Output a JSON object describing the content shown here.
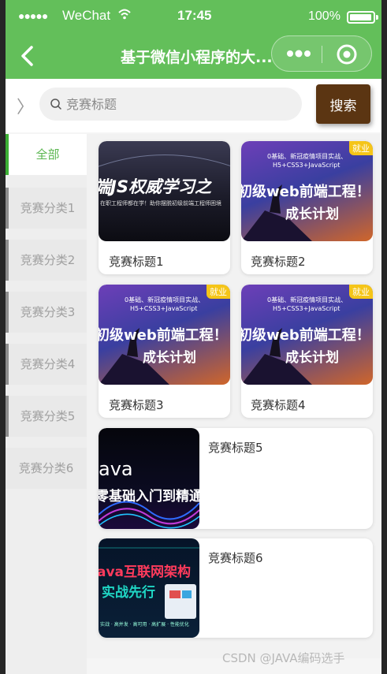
{
  "status_bar": {
    "signal_dots": "●●●●●",
    "carrier": "WeChat",
    "time": "17:45",
    "battery": "100%"
  },
  "nav": {
    "title": "基于微信小程序的大..."
  },
  "search": {
    "placeholder": "竞赛标题",
    "value": "",
    "button_label": "搜索",
    "expand_glyph": "〉"
  },
  "sidebar": {
    "items": [
      {
        "label": "全部",
        "active": true
      },
      {
        "label": "竞赛分类1"
      },
      {
        "label": "竞赛分类2"
      },
      {
        "label": "竞赛分类3"
      },
      {
        "label": "竞赛分类4"
      },
      {
        "label": "竞赛分类5"
      },
      {
        "label": "竞赛分类6"
      }
    ]
  },
  "cards": [
    {
      "title": "竞赛标题1",
      "thumb_lines": [
        "端JS权威学习之",
        "在职工程师都在学！助你摆脱初级前端工程师困境"
      ]
    },
    {
      "title": "竞赛标题2",
      "thumb_lines": [
        "0基础、新冠疫情项目实战、",
        "H5+CSS3+JavaScript",
        "初级web前端工程！",
        "成长计划"
      ],
      "badge": "就业"
    },
    {
      "title": "竞赛标题3",
      "thumb_lines": [
        "0基础、新冠疫情项目实战、",
        "H5+CSS3+JavaScript",
        "初级web前端工程！",
        "成长计划"
      ],
      "badge": "就业"
    },
    {
      "title": "竞赛标题4",
      "thumb_lines": [
        "0基础、新冠疫情项目实战、",
        "H5+CSS3+JavaScript",
        "初级web前端工程！",
        "成长计划"
      ],
      "badge": "就业"
    },
    {
      "title": "竞赛标题5",
      "thumb_lines": [
        "ava",
        "零基础入门到精通"
      ]
    },
    {
      "title": "竞赛标题6",
      "thumb_lines": [
        "ava互联网架构",
        "实战先行",
        "实战 · 高并发 · 高可用 · 高扩展 · 性能优化"
      ]
    }
  ],
  "watermark": "CSDN @JAVA编码选手",
  "colors": {
    "brand_green": "#63bf5a",
    "search_button": "#5b3512",
    "active_sidebar": "#5ab64f"
  }
}
